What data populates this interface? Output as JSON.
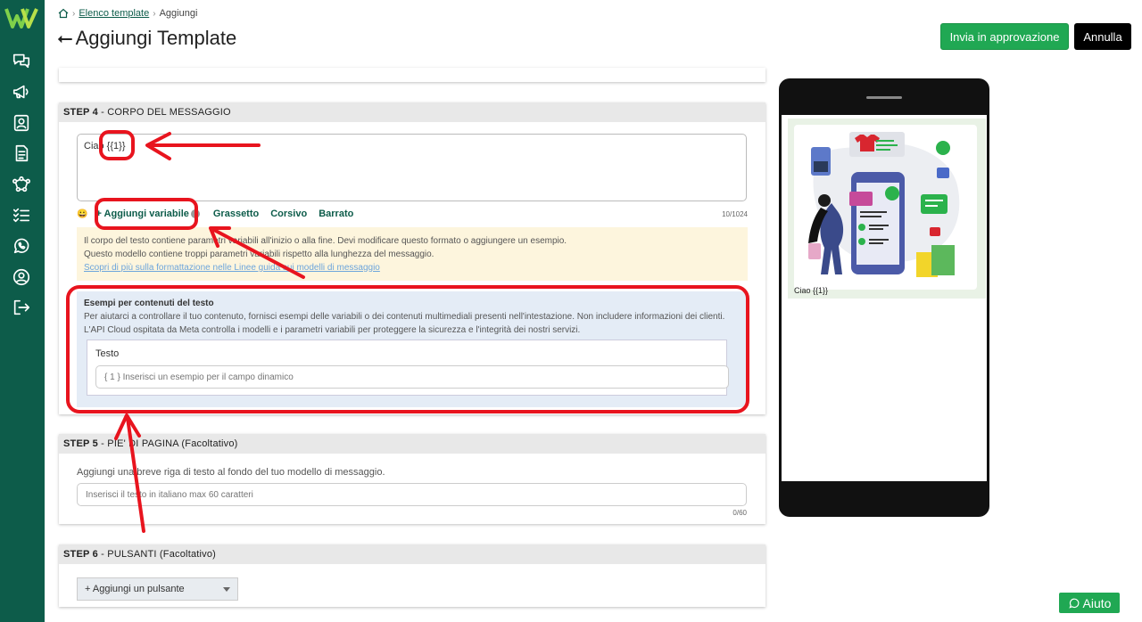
{
  "breadcrumb": {
    "template_list": "Elenco template",
    "current": "Aggiungi"
  },
  "header": {
    "title": "Aggiungi Template",
    "approve_label": "Invia in approvazione",
    "cancel_label": "Annulla"
  },
  "step4": {
    "step": "STEP 4",
    "title": " - CORPO DEL MESSAGGIO",
    "body_text": "Ciao {{1}}",
    "add_variable": "+ Aggiungi variabile",
    "bold": "Grassetto",
    "italic": "Corsivo",
    "strike": "Barrato",
    "counter": "10/1024",
    "warning_line1": "Il corpo del testo contiene parametri variabili all'inizio o alla fine. Devi modificare questo formato o aggiungere un esempio.",
    "warning_line2": "Questo modello contiene troppi parametri variabili rispetto alla lunghezza del messaggio.",
    "warning_link": "Scopri di più sulla formattazione nelle Linee guida sui modelli di messaggio",
    "examples_title": "Esempi per contenuti del testo",
    "examples_desc": "Per aiutarci a controllare il tuo contenuto, fornisci esempi delle variabili o dei contenuti multimediali presenti nell'intestazione. Non includere informazioni dei clienti. L'API Cloud ospitata da Meta controlla i modelli e i parametri variabili per proteggere la sicurezza e l'integrità dei nostri servizi.",
    "examples_label": "Testo",
    "examples_placeholder": "{ 1 } Inserisci un esempio per il campo dinamico"
  },
  "step5": {
    "step": "STEP 5",
    "title": " - PIE' DI PAGINA (Facoltativo)",
    "desc": "Aggiungi una breve riga di testo al fondo del tuo modello di messaggio.",
    "placeholder": "Inserisci il testo in italiano max 60 caratteri",
    "counter": "0/60"
  },
  "step6": {
    "step": "STEP 6",
    "title": " - PULSANTI (Facoltativo)",
    "add_button": "+ Aggiungi un pulsante"
  },
  "preview": {
    "message": "Ciao {{1}}"
  },
  "help_label": "Aiuto",
  "sidebar_icons": [
    "chat-icon",
    "megaphone-icon",
    "contacts-icon",
    "document-icon",
    "flow-icon",
    "checklist-icon",
    "whatsapp-icon",
    "user-icon",
    "logout-icon"
  ],
  "colors": {
    "sidebar": "#0d5c4a",
    "accent_green": "#20a853",
    "annotation_red": "#e8141e"
  }
}
